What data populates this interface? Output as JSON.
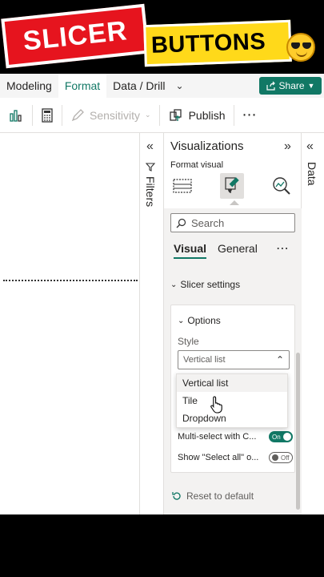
{
  "banner": {
    "left": "SLICER",
    "right": "BUTTONS"
  },
  "ribbon": {
    "tabs": [
      "Modeling",
      "Format",
      "Data / Drill"
    ],
    "active_tab": "Format",
    "share_label": "Share",
    "tools": {
      "sensitivity": "Sensitivity",
      "publish": "Publish"
    }
  },
  "filters_label": "Filters",
  "data_label": "Data",
  "visualizations": {
    "title": "Visualizations",
    "format_visual": "Format visual",
    "search_placeholder": "Search",
    "tabs": {
      "visual": "Visual",
      "general": "General"
    },
    "slicer_settings": "Slicer settings",
    "options": {
      "title": "Options",
      "style_label": "Style",
      "style_value": "Vertical list",
      "style_options": [
        "Vertical list",
        "Tile",
        "Dropdown"
      ],
      "multi_select_label": "Multi-select with C...",
      "multi_select_state": "On",
      "select_all_label": "Show \"Select all\" o...",
      "select_all_state": "Off"
    },
    "reset_label": "Reset to default"
  },
  "colors": {
    "accent": "#117865",
    "banner_red": "#e6141e",
    "banner_yellow": "#ffd91a"
  }
}
